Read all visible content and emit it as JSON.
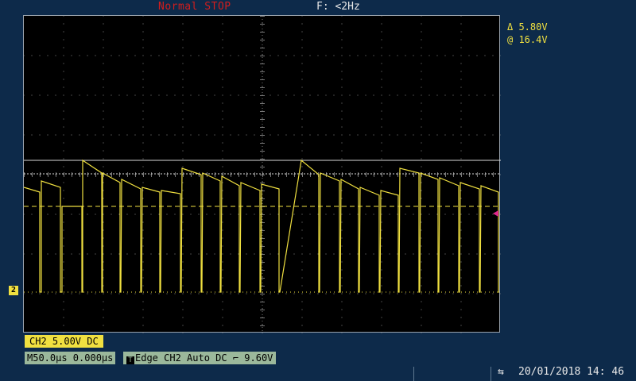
{
  "status": {
    "trigger_mode": "Normal  STOP",
    "frequency": "F: <2Hz"
  },
  "trigger_position_marker": "⊕",
  "cursor": {
    "delta": "Δ  5.80V",
    "at": "@  16.4V"
  },
  "channel": {
    "marker": "2",
    "badge": "CH2  5.00V  DC",
    "color": "#f0e040"
  },
  "timebase": "M50.0µs  0.000µs",
  "trigger": {
    "icon": "T",
    "text": "Edge  CH2  Auto  DC ⌐  9.60V",
    "level_color": "#e0288c"
  },
  "usb_icon": "usb-icon",
  "datetime": "20/01/2018  14: 46",
  "colors": {
    "background": "#0d2a4a",
    "screen": "#000000",
    "grid": "#8a8a8a",
    "trace": "#f0e040",
    "timebase_badge": "#9bb89b",
    "status_red": "#d21d1d"
  }
}
